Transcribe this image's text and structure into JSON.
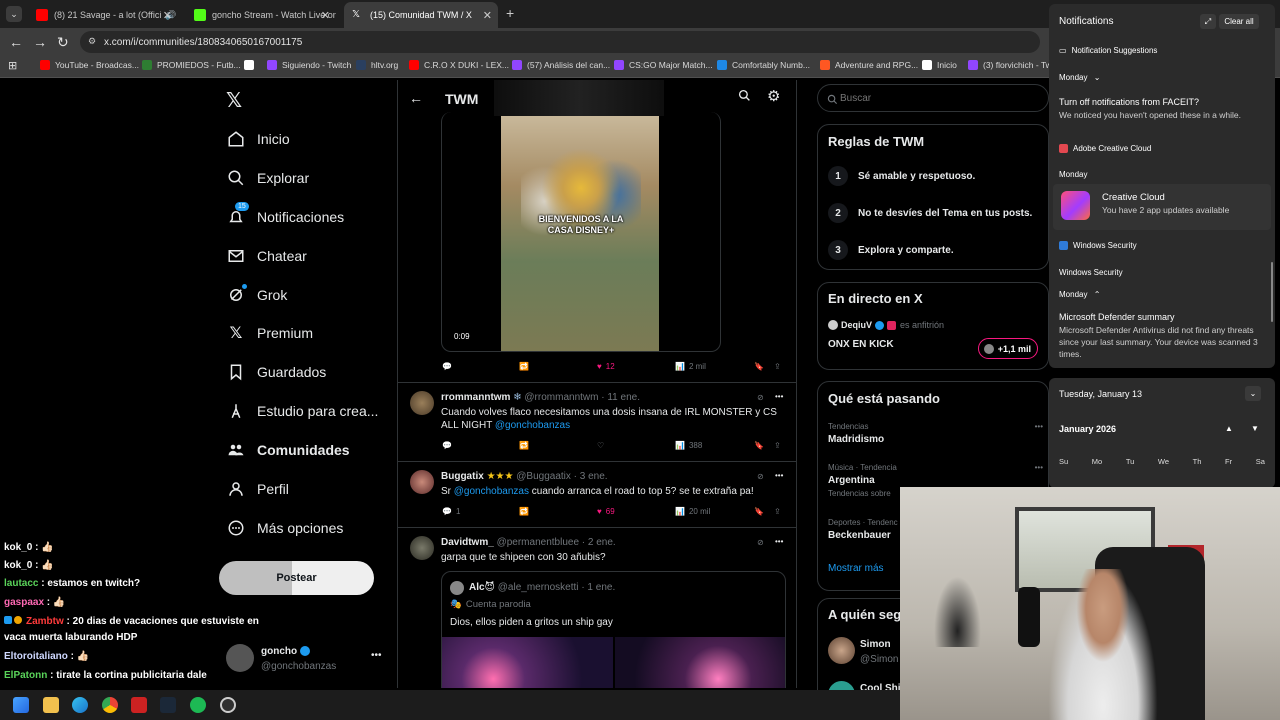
{
  "browser": {
    "tabs": [
      {
        "title": "(8) 21 Savage - a lot (Offici",
        "color": "#ff0000"
      },
      {
        "title": "goncho Stream - Watch Live on",
        "color": "#53fc18"
      },
      {
        "title": "(15) Comunidad TWM / X",
        "color": "#ffffff"
      }
    ],
    "new_tab": "+",
    "url": "x.com/i/communities/1808340650167001175",
    "bookmarks": [
      {
        "label": "YouTube - Broadcas...",
        "color": "#ff0000"
      },
      {
        "label": "PROMIEDOS - Futb...",
        "color": "#2e7d32"
      },
      {
        "label": "Siguiendo - Twitch",
        "color": "#9146ff"
      },
      {
        "label": "hltv.org",
        "color": "#2a3f5f"
      },
      {
        "label": "C.R.O X DUKI - LEX...",
        "color": "#ff0000"
      },
      {
        "label": "(57) Análisis del can...",
        "color": "#9146ff"
      },
      {
        "label": "CS:GO Major Match...",
        "color": "#9146ff"
      },
      {
        "label": "Comfortably Numb...",
        "color": "#1e88e5"
      },
      {
        "label": "Adventure and RPG...",
        "color": "#ff5722"
      },
      {
        "label": "Inicio",
        "color": "#ffffff"
      },
      {
        "label": "(3) florvichich - Twi",
        "color": "#9146ff"
      }
    ]
  },
  "nav": {
    "items": [
      {
        "label": "Inicio",
        "icon": "home-icon"
      },
      {
        "label": "Explorar",
        "icon": "search-icon"
      },
      {
        "label": "Notificaciones",
        "icon": "bell-icon",
        "badge": "15"
      },
      {
        "label": "Chatear",
        "icon": "mail-icon"
      },
      {
        "label": "Grok",
        "icon": "grok-icon"
      },
      {
        "label": "Premium",
        "icon": "x-logo-icon"
      },
      {
        "label": "Guardados",
        "icon": "bookmark-icon"
      },
      {
        "label": "Estudio para crea...",
        "icon": "studio-icon"
      },
      {
        "label": "Comunidades",
        "icon": "communities-icon"
      },
      {
        "label": "Perfil",
        "icon": "person-icon"
      },
      {
        "label": "Más opciones",
        "icon": "more-icon"
      }
    ],
    "post_button": "Postear",
    "account": {
      "name": "goncho",
      "handle": "@gonchobanzas"
    }
  },
  "chat": [
    {
      "user": "kok_0",
      "color": "#ffffff",
      "msg": " : 👍🏻"
    },
    {
      "user": "kok_0",
      "color": "#ffffff",
      "msg": " : 👍🏻"
    },
    {
      "user": "lautacc",
      "color": "#5ad45a",
      "msg": " : estamos en twitch?"
    },
    {
      "user": "gaspaax",
      "color": "#ff69b4",
      "msg": " : 👍🏻"
    },
    {
      "user": "Zambtw",
      "color": "#ff3b3b",
      "msg": " : 20 dias de vacaciones que estuviste en"
    },
    {
      "user": "",
      "color": "#ffffff",
      "msg": "vaca muerta laburando HDP"
    },
    {
      "user": "Eltoroitaliano",
      "color": "#cfd8ff",
      "msg": " : 👍🏻"
    },
    {
      "user": "ElPatonn",
      "color": "#5ad45a",
      "msg": " : tirate la cortina publicitaria dale"
    }
  ],
  "feed": {
    "header_title": "TWM",
    "video": {
      "caption": "BIENVENIDOS A LA CASA DISNEY+",
      "time": "0:09"
    },
    "video_actions": {
      "likes": "12",
      "views": "2 mil"
    },
    "tweets": [
      {
        "name": "rrommanntwm",
        "badge": "❄",
        "handle": "@rrommanntwm",
        "date": "· 11 ene.",
        "text": "Cuando volves flaco necesitamos una dosis insana de IRL MONSTER y CS ALL NIGHT ",
        "mention": "@gonchobanzas",
        "views": "388"
      },
      {
        "name": "Buggatix",
        "badge": "★★★",
        "handle": "@Buggaatix",
        "date": "· 3 ene.",
        "text_pre": "Sr ",
        "mention": "@gonchobanzas",
        "text_post": " cuando arranca el road to top 5? se te extraña pa!",
        "replies": "1",
        "likes": "69",
        "views": "20 mil"
      },
      {
        "name": "Davidtwm_",
        "handle": "@permanentbluee",
        "date": "· 2 ene.",
        "text": "garpa que te shipeen con 30 añubis?",
        "quote": {
          "name": "Alc😈",
          "handle": "@ale_mernosketti",
          "date": "· 1 ene.",
          "label": "Cuenta parodia",
          "text": "Dios, ellos piden a gritos un ship gay"
        }
      }
    ]
  },
  "right": {
    "search_placeholder": "Buscar",
    "rules": {
      "title": "Reglas de TWM",
      "items": [
        {
          "n": "1",
          "text": "Sé amable y respetuoso."
        },
        {
          "n": "2",
          "text": "No te desvíes del Tema en tus posts."
        },
        {
          "n": "3",
          "text": "Explora y comparte."
        }
      ]
    },
    "live": {
      "title": "En directo en X",
      "host": "DeqiuV",
      "host_suffix": "es anfitrión",
      "stream": "ONX EN KICK",
      "viewers": "+1,1 mil"
    },
    "trending": {
      "title": "Qué está pasando",
      "items": [
        {
          "meta": "Tendencias",
          "name": "Madridismo"
        },
        {
          "meta": "Música · Tendencia",
          "name": "Argentina",
          "sub": "Tendencias sobre"
        },
        {
          "meta": "Deportes · Tendenc",
          "name": "Beckenbauer"
        }
      ],
      "more": "Mostrar más"
    },
    "follow": {
      "title": "A quién seg",
      "items": [
        {
          "name": "Simon",
          "handle": "@Simon"
        },
        {
          "name": "Cool Shi",
          "handle": ""
        }
      ]
    }
  },
  "notifications": {
    "title": "Notifications",
    "clear_all": "Clear all",
    "suggestions_label": "Notification Suggestions",
    "group1_day": "Monday",
    "faceit_title": "Turn off notifications from FACEIT?",
    "faceit_body": "We noticed you haven't opened these in a while.",
    "adobe_app": "Adobe Creative Cloud",
    "adobe_day": "Monday",
    "adobe_title": "Creative Cloud",
    "adobe_body": "You have 2 app updates available",
    "security_app": "Windows Security",
    "security_sub": "Windows Security",
    "security_day": "Monday",
    "defender_title": "Microsoft Defender summary",
    "defender_body": "Microsoft Defender Antivirus did not find any threats since your last summary. Your device was scanned 3 times."
  },
  "calendar": {
    "date": "Tuesday, January 13",
    "month": "January 2026",
    "days": [
      "Su",
      "Mo",
      "Tu",
      "We",
      "Th",
      "Fr",
      "Sa"
    ]
  }
}
